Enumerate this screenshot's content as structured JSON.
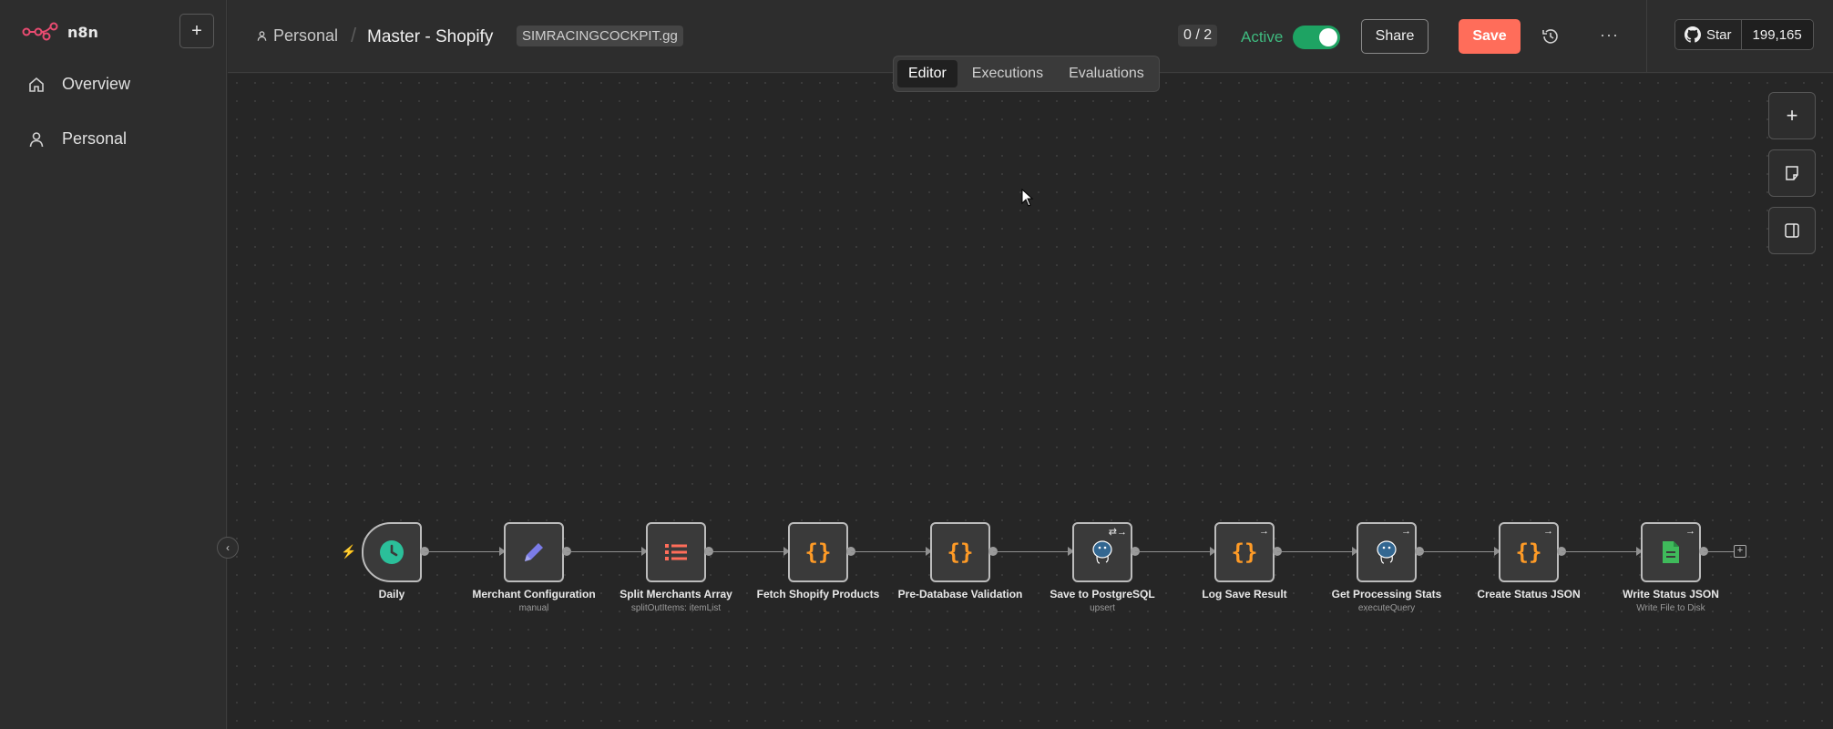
{
  "sidebar": {
    "brand": "n8n",
    "items": [
      {
        "label": "Overview"
      },
      {
        "label": "Personal"
      }
    ]
  },
  "header": {
    "breadcrumb_project": "Personal",
    "workflow_title": "Master - Shopify",
    "tag": "SIMRACINGCOCKPIT.gg",
    "counter": "0 / 2",
    "active_label": "Active",
    "active": true,
    "share_label": "Share",
    "save_label": "Save",
    "github_star_label": "Star",
    "github_star_count": "199,165"
  },
  "tabs": [
    {
      "label": "Editor",
      "active": true
    },
    {
      "label": "Executions",
      "active": false
    },
    {
      "label": "Evaluations",
      "active": false
    }
  ],
  "workflow": {
    "nodes": [
      {
        "name": "Daily",
        "subtitle": "",
        "icon": "clock-icon",
        "color": "#2bbf9a"
      },
      {
        "name": "Merchant Configuration",
        "subtitle": "manual",
        "icon": "pencil-icon",
        "color": "#7b7ce8"
      },
      {
        "name": "Split Merchants Array",
        "subtitle": "splitOutItems: itemList",
        "icon": "list-icon",
        "color": "#ff6d5a"
      },
      {
        "name": "Fetch Shopify Products",
        "subtitle": "",
        "icon": "code-braces-icon",
        "color": "#ff9b26"
      },
      {
        "name": "Pre-Database Validation",
        "subtitle": "",
        "icon": "code-braces-icon",
        "color": "#ff9b26"
      },
      {
        "name": "Save to PostgreSQL",
        "subtitle": "upsert",
        "icon": "postgres-icon",
        "color": "#336791"
      },
      {
        "name": "Log Save Result",
        "subtitle": "",
        "icon": "code-braces-icon",
        "color": "#ff9b26"
      },
      {
        "name": "Get Processing Stats",
        "subtitle": "executeQuery",
        "icon": "postgres-icon",
        "color": "#336791"
      },
      {
        "name": "Create Status JSON",
        "subtitle": "",
        "icon": "code-braces-icon",
        "color": "#ff9b26"
      },
      {
        "name": "Write Status JSON",
        "subtitle": "Write File to Disk",
        "icon": "file-write-icon",
        "color": "#3fba5b"
      }
    ]
  },
  "colors": {
    "accent": "#ff6d5a",
    "active_green": "#1ea363"
  }
}
